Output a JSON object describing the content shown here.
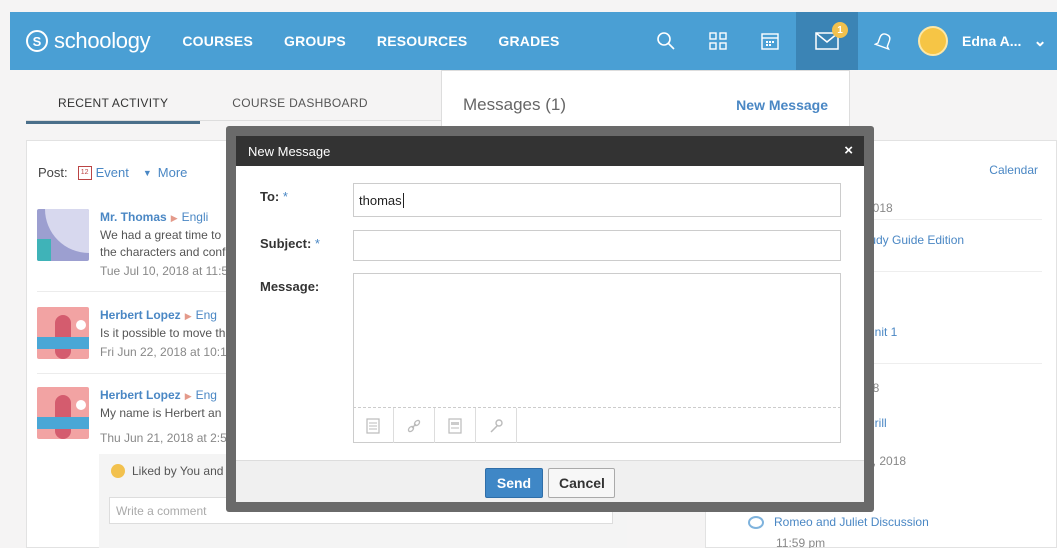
{
  "app": {
    "logo_letter": "S",
    "logo_text": "schoology"
  },
  "nav": [
    "COURSES",
    "GROUPS",
    "RESOURCES",
    "GRADES"
  ],
  "nav_icons": [
    "search-icon",
    "apps-grid-icon",
    "calendar-icon",
    "mail-icon",
    "bell-icon"
  ],
  "mail_badge": "1",
  "user": {
    "name": "Edna A..."
  },
  "tabs": [
    "RECENT ACTIVITY",
    "COURSE DASHBOARD"
  ],
  "post_bar": {
    "label": "Post:",
    "cal_day": "12",
    "event": "Event",
    "more": "More"
  },
  "feed": [
    {
      "author": "Mr. Thomas",
      "course": "Engli",
      "line1": "We had a great time to",
      "line2": "the characters and conf",
      "date": "Tue Jul 10, 2018 at 11:5"
    },
    {
      "author": "Herbert Lopez",
      "course": "Eng",
      "line1": "Is it possible to move th",
      "line2": "",
      "date": "Fri Jun 22, 2018 at 10:1"
    },
    {
      "author": "Herbert Lopez",
      "course": "Eng",
      "line1": "My name is Herbert an",
      "line2": "",
      "date": "Thu Jun 21, 2018 at 2:5"
    }
  ],
  "liked": "Liked by You and 1",
  "comment_placeholder": "Write a comment",
  "messages_panel": {
    "title": "Messages (1)",
    "new_message": "New Message"
  },
  "sidebar": {
    "calendar": "Calendar",
    "lines": [
      "2018",
      "tudy Guide Edition",
      "8",
      "Unit 1",
      "18",
      "Drill",
      "3, 2018"
    ],
    "event": "Romeo and Juliet Discussion",
    "event_time": "11:59 pm"
  },
  "modal": {
    "title": "New Message",
    "close": "×",
    "to_label": "To:",
    "subject_label": "Subject:",
    "message_label": "Message:",
    "required_mark": "*",
    "to_value": "thomas",
    "send": "Send",
    "cancel": "Cancel",
    "toolbar_icons": [
      "attach-file-icon",
      "link-icon",
      "resource-icon",
      "embed-icon"
    ]
  }
}
